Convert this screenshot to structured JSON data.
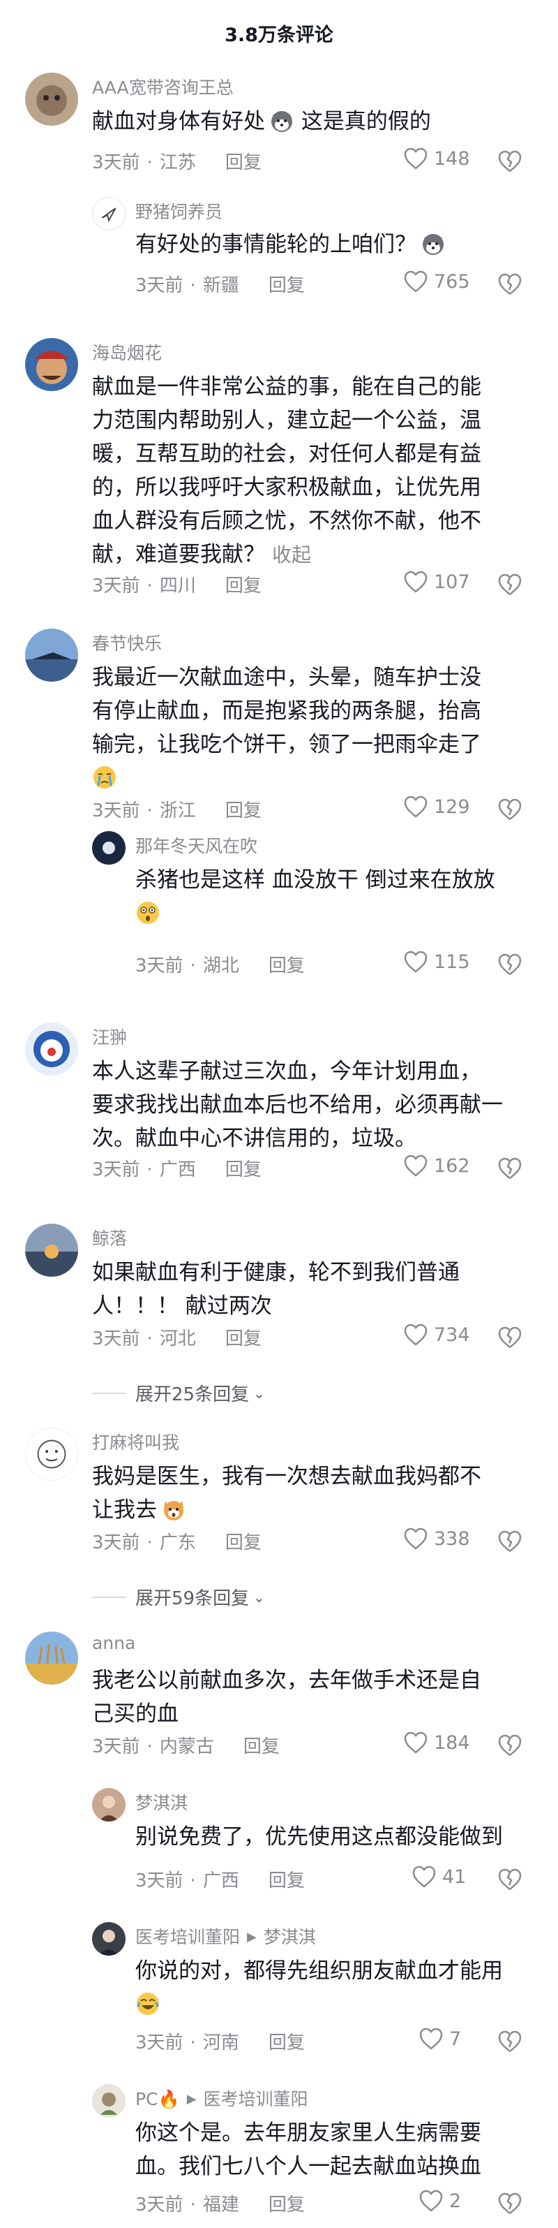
{
  "header": {
    "title": "3.8万条评论"
  },
  "comments": [
    {
      "name": "AAA宽带咨询王总",
      "text": "献血对身体有好处",
      "emoji": "husky",
      "text_after": " 这是真的假的",
      "time": "3天前",
      "location": "江苏",
      "reply": "回复",
      "likes": "148"
    },
    {
      "name": "野猪饲养员",
      "text": "有好处的事情能轮的上咱们？",
      "emoji": "husky",
      "time": "3天前",
      "location": "新疆",
      "reply": "回复",
      "likes": "765"
    },
    {
      "name": "海岛烟花",
      "lines": [
        "献血是一件非常公益的事，能在自己的能",
        "力范围内帮助别人，建立起一个公益，温",
        "暖，互帮互助的社会，对任何人都是有益",
        "的，所以我呼吁大家积极献血，让优先用",
        "血人群没有后顾之忧，不然你不献，他不",
        "献，难道要我献？"
      ],
      "collapse": "收起",
      "time": "3天前",
      "location": "四川",
      "reply": "回复",
      "likes": "107"
    },
    {
      "name": "春节快乐",
      "lines": [
        "我最近一次献血途中，头晕，随车护士没",
        "有停止献血，而是抱紧我的两条腿，抬高",
        "输完，让我吃个饼干，领了一把雨伞走了"
      ],
      "emoji_line": "cry",
      "time": "3天前",
      "location": "浙江",
      "reply": "回复",
      "likes": "129"
    },
    {
      "name": "那年冬天风在吹",
      "lines": [
        "杀猪也是这样 血没放干 倒过来在放放"
      ],
      "emoji_line": "shock",
      "time": "3天前",
      "location": "湖北",
      "reply": "回复",
      "likes": "115"
    },
    {
      "name": "汪翀",
      "lines": [
        "本人这辈子献过三次血，今年计划用血，",
        "要求我找出献血本后也不给用，必须再献一",
        "次。献血中心不讲信用的，垃圾。"
      ],
      "time": "3天前",
      "location": "广西",
      "reply": "回复",
      "likes": "162"
    },
    {
      "name": "鲸落",
      "lines": [
        "如果献血有利于健康，轮不到我们普通",
        "人！！！ 献过两次"
      ],
      "time": "3天前",
      "location": "河北",
      "reply": "回复",
      "likes": "734"
    },
    {
      "name": "打麻将叫我",
      "lines": [
        "我妈是医生，我有一次想去献血我妈都不",
        "让我去"
      ],
      "emoji": "cat",
      "time": "3天前",
      "location": "广东",
      "reply": "回复",
      "likes": "338"
    },
    {
      "name": "anna",
      "lines": [
        "我老公以前献血多次，去年做手术还是自",
        "己买的血"
      ],
      "time": "3天前",
      "location": "内蒙古",
      "reply": "回复",
      "likes": "184"
    },
    {
      "name": "梦淇淇",
      "lines": [
        "别说免费了，优先使用这点都没能做到"
      ],
      "time": "3天前",
      "location": "广西",
      "reply": "回复",
      "likes": "41"
    },
    {
      "name": "医考培训董阳",
      "reply_to": "梦淇淇",
      "lines": [
        "你说的对，都得先组织朋友献血才能用"
      ],
      "emoji_line": "laugh",
      "time": "3天前",
      "location": "河南",
      "reply": "回复",
      "likes": "7"
    },
    {
      "name": "PC",
      "reply_to": "医考培训董阳",
      "lines": [
        "你这个是。去年朋友家里人生病需要",
        "血。我们七八个人一起去献血站换血"
      ],
      "time": "3天前",
      "location": "福建",
      "reply": "回复",
      "likes": "2"
    }
  ],
  "expanders": [
    {
      "label": "展开25条回复"
    },
    {
      "label": "展开59条回复"
    }
  ],
  "colors": {
    "text": "#161823",
    "secondary": "#8a8b91",
    "background": "#ffffff"
  }
}
